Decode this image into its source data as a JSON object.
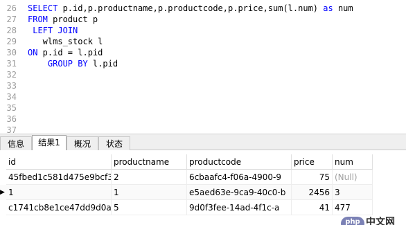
{
  "editor": {
    "lines": [
      {
        "num": "26",
        "parts": [
          {
            "t": "SELECT ",
            "kw": true
          },
          {
            "t": "p.id,p.productname,p.productcode,p.price,sum(l.num) ",
            "kw": false
          },
          {
            "t": "as",
            "kw": true
          },
          {
            "t": " num",
            "kw": false
          }
        ]
      },
      {
        "num": "27",
        "parts": [
          {
            "t": "FROM",
            "kw": true
          },
          {
            "t": " product p",
            "kw": false
          }
        ]
      },
      {
        "num": "28",
        "parts": [
          {
            "t": " LEFT JOIN",
            "kw": true
          }
        ]
      },
      {
        "num": "29",
        "parts": [
          {
            "t": "   wlms_stock l",
            "kw": false
          }
        ]
      },
      {
        "num": "30",
        "parts": [
          {
            "t": "ON",
            "kw": true
          },
          {
            "t": " p.id = l.pid",
            "kw": false
          }
        ]
      },
      {
        "num": "31",
        "parts": [
          {
            "t": "    ",
            "kw": false
          },
          {
            "t": "GROUP BY",
            "kw": true
          },
          {
            "t": " l.pid",
            "kw": false
          }
        ]
      },
      {
        "num": "32",
        "parts": []
      },
      {
        "num": "33",
        "parts": []
      },
      {
        "num": "34",
        "parts": []
      },
      {
        "num": "35",
        "parts": []
      },
      {
        "num": "36",
        "parts": []
      },
      {
        "num": "37",
        "parts": []
      }
    ]
  },
  "tabs": [
    {
      "label": "信息",
      "active": false
    },
    {
      "label": "结果1",
      "active": true
    },
    {
      "label": "概况",
      "active": false
    },
    {
      "label": "状态",
      "active": false
    }
  ],
  "grid": {
    "columns": [
      "id",
      "productname",
      "productcode",
      "price",
      "num"
    ],
    "rows": [
      {
        "id": "45fbed1c581d475e9bcf37",
        "productname": "2",
        "productcode": "6cbaafc4-f06a-4900-9",
        "price": "75",
        "num": "(Null)",
        "num_null": true,
        "current": false
      },
      {
        "id": "1",
        "productname": "1",
        "productcode": "e5aed63e-9ca9-40c0-b",
        "price": "2456",
        "num": "3",
        "num_null": false,
        "current": true
      },
      {
        "id": "c1741cb8e1ce47dd9d0ad",
        "productname": "5",
        "productcode": "9d0f3fee-14ad-4f1c-a",
        "price": "41",
        "num": "477",
        "num_null": false,
        "current": false
      }
    ],
    "current_row_marker": "▶"
  },
  "watermark": {
    "pill": "php",
    "text": "中文网"
  },
  "colors": {
    "keyword": "#0000ff",
    "null": "#a0a0a0",
    "line_number": "#9a9a9a"
  }
}
